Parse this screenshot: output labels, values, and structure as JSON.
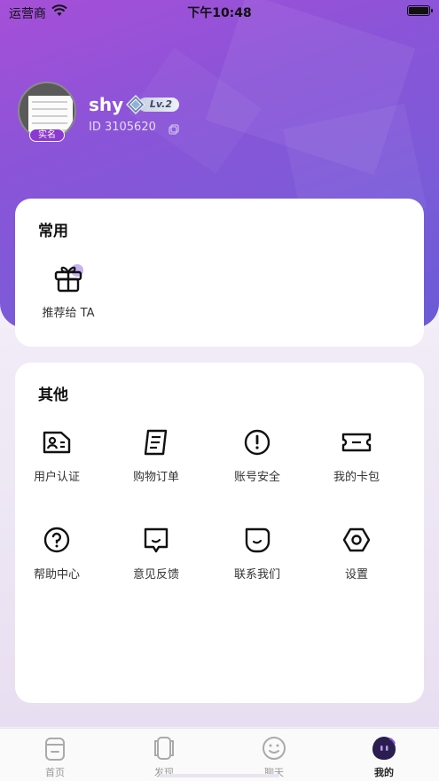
{
  "status_bar": {
    "carrier": "运营商",
    "time": "下午10:48"
  },
  "profile": {
    "username": "shy",
    "level": "Lv.2",
    "user_id": "ID 3105620",
    "realname_badge": "实名"
  },
  "common": {
    "title": "常用",
    "items": [
      {
        "label": "推荐给 TA",
        "icon": "gift-icon"
      }
    ]
  },
  "other": {
    "title": "其他",
    "items": [
      {
        "label": "用户认证",
        "icon": "id-card-icon"
      },
      {
        "label": "购物订单",
        "icon": "order-list-icon"
      },
      {
        "label": "账号安全",
        "icon": "shield-alert-icon"
      },
      {
        "label": "我的卡包",
        "icon": "ticket-icon"
      },
      {
        "label": "帮助中心",
        "icon": "help-icon"
      },
      {
        "label": "意见反馈",
        "icon": "feedback-icon"
      },
      {
        "label": "联系我们",
        "icon": "contact-icon"
      },
      {
        "label": "设置",
        "icon": "settings-icon"
      }
    ]
  },
  "tabbar": {
    "tabs": [
      {
        "label": "首页",
        "icon": "home-icon",
        "active": false
      },
      {
        "label": "发现",
        "icon": "discover-icon",
        "active": false
      },
      {
        "label": "聊天",
        "icon": "chat-icon",
        "active": false
      },
      {
        "label": "我的",
        "icon": "profile-icon",
        "active": true
      }
    ]
  },
  "colors": {
    "accent": "#8b54d8",
    "badge": "#8b3ad0"
  }
}
